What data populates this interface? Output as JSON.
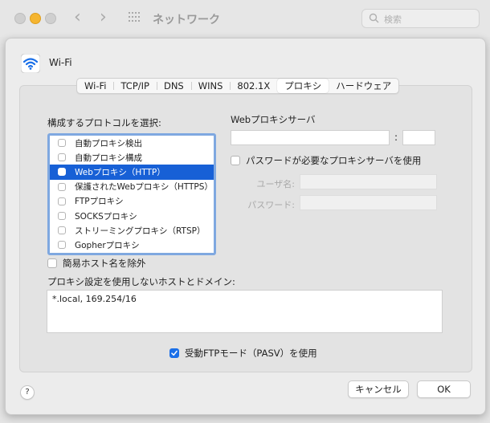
{
  "titlebar": {
    "title": "ネットワーク",
    "search_placeholder": "検索"
  },
  "interface": {
    "name": "Wi-Fi"
  },
  "tabs": [
    {
      "label": "Wi-Fi"
    },
    {
      "label": "TCP/IP"
    },
    {
      "label": "DNS"
    },
    {
      "label": "WINS"
    },
    {
      "label": "802.1X"
    },
    {
      "label": "プロキシ",
      "active": true
    },
    {
      "label": "ハードウェア"
    }
  ],
  "proxy": {
    "protocol_heading": "構成するプロトコルを選択:",
    "protocols": [
      {
        "label": "自動プロキシ検出",
        "checked": false,
        "selected": false
      },
      {
        "label": "自動プロキシ構成",
        "checked": false,
        "selected": false
      },
      {
        "label": "Webプロキシ（HTTP）",
        "checked": false,
        "selected": true
      },
      {
        "label": "保護されたWebプロキシ（HTTPS）",
        "checked": false,
        "selected": false
      },
      {
        "label": "FTPプロキシ",
        "checked": false,
        "selected": false
      },
      {
        "label": "SOCKSプロキシ",
        "checked": false,
        "selected": false
      },
      {
        "label": "ストリーミングプロキシ（RTSP）",
        "checked": false,
        "selected": false
      },
      {
        "label": "Gopherプロキシ",
        "checked": false,
        "selected": false
      }
    ],
    "server_heading": "Webプロキシサーバ",
    "server_value": "",
    "port_value": "",
    "port_separator": ":",
    "password_required_label": "パスワードが必要なプロキシサーバを使用",
    "username_label": "ユーザ名:",
    "password_label": "パスワード:",
    "exclude_simple_hosts_label": "簡易ホスト名を除外",
    "bypass_heading": "プロキシ設定を使用しないホストとドメイン:",
    "bypass_value": "*.local, 169.254/16",
    "passive_ftp_label": "受動FTPモード（PASV）を使用",
    "passive_ftp_checked": true
  },
  "buttons": {
    "help": "?",
    "cancel": "キャンセル",
    "ok": "OK"
  },
  "colors": {
    "selection": "#1760d6",
    "list_focus_ring": "#7fa8e0",
    "checkbox_checked": "#1a6fe8",
    "minimize_light": "#f5b530"
  }
}
